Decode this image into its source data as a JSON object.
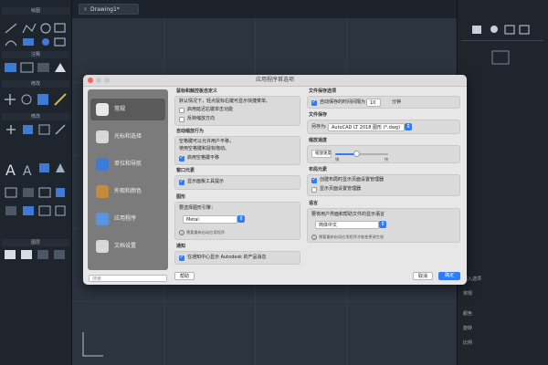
{
  "titlebar": {
    "doc_tab": "Drawing1*"
  },
  "left_panel": {
    "sections": [
      {
        "title": "绘图"
      },
      {
        "title": "注释"
      },
      {
        "title": "修改"
      },
      {
        "title": "修改"
      },
      {
        "title": "图层"
      }
    ]
  },
  "right_panel": {
    "section_title": "插入选项",
    "rows": [
      "常规",
      "颜色",
      "旋转",
      "比例"
    ]
  },
  "dialog": {
    "title": "应用程序首选项",
    "sidebar": [
      {
        "label": "常规"
      },
      {
        "label": "光标和选择"
      },
      {
        "label": "单位和导航"
      },
      {
        "label": "外观和颜色"
      },
      {
        "label": "应用程序"
      },
      {
        "label": "文档设置"
      }
    ],
    "search_placeholder": "搜索",
    "col1": {
      "s1_title": "鼠标和触控板自定义",
      "s1_text1": "默认情况下，轻点鼠标右键可显示快捷菜单。",
      "s1_opt1": "启用延迟右键单击功能",
      "s1_opt2": "反转缩放方向",
      "s2_title": "自动缩放行为",
      "s2_text1": "空格键可以允许用户平移，",
      "s2_text2": "使用空格键和鼠标拖动。",
      "s2_opt1": "启用空格键平移",
      "s3_title": "窗口元素",
      "s3_opt1": "显示面板工具提示",
      "s4_title": "图形",
      "s4_text1": "要选择图形引擎：",
      "s4_select": "Metal",
      "s4_note": "需要重新启动应用程序",
      "s5_title": "通知",
      "s5_opt1": "在通知中心显示 Autodesk 的产品消息"
    },
    "col2": {
      "s1_title": "文件保存选项",
      "s1_opt1": "自动保存的时间间隔为",
      "s1_value": "10",
      "s1_unit": "分钟",
      "s2_title": "文件保存",
      "s2_label": "另存为:",
      "s2_select": "AutoCAD LT 2018 图形 (*.dwg)",
      "s3_title": "缩放速度",
      "s3_label": "缩放速度",
      "s3_slow": "慢",
      "s3_fast": "快",
      "s4_title": "布局元素",
      "s4_opt1": "创建布局时显示页面设置管理器",
      "s4_opt2": "显示页面设置管理器",
      "s5_title": "语言",
      "s5_text1": "要将用户界面和帮助文件的显示语言",
      "s5_select": "简体中文",
      "s5_note": "需要重新启动应用程序才能使更改生效"
    },
    "buttons": {
      "help": "帮助",
      "cancel": "取消",
      "ok": "确定"
    }
  }
}
